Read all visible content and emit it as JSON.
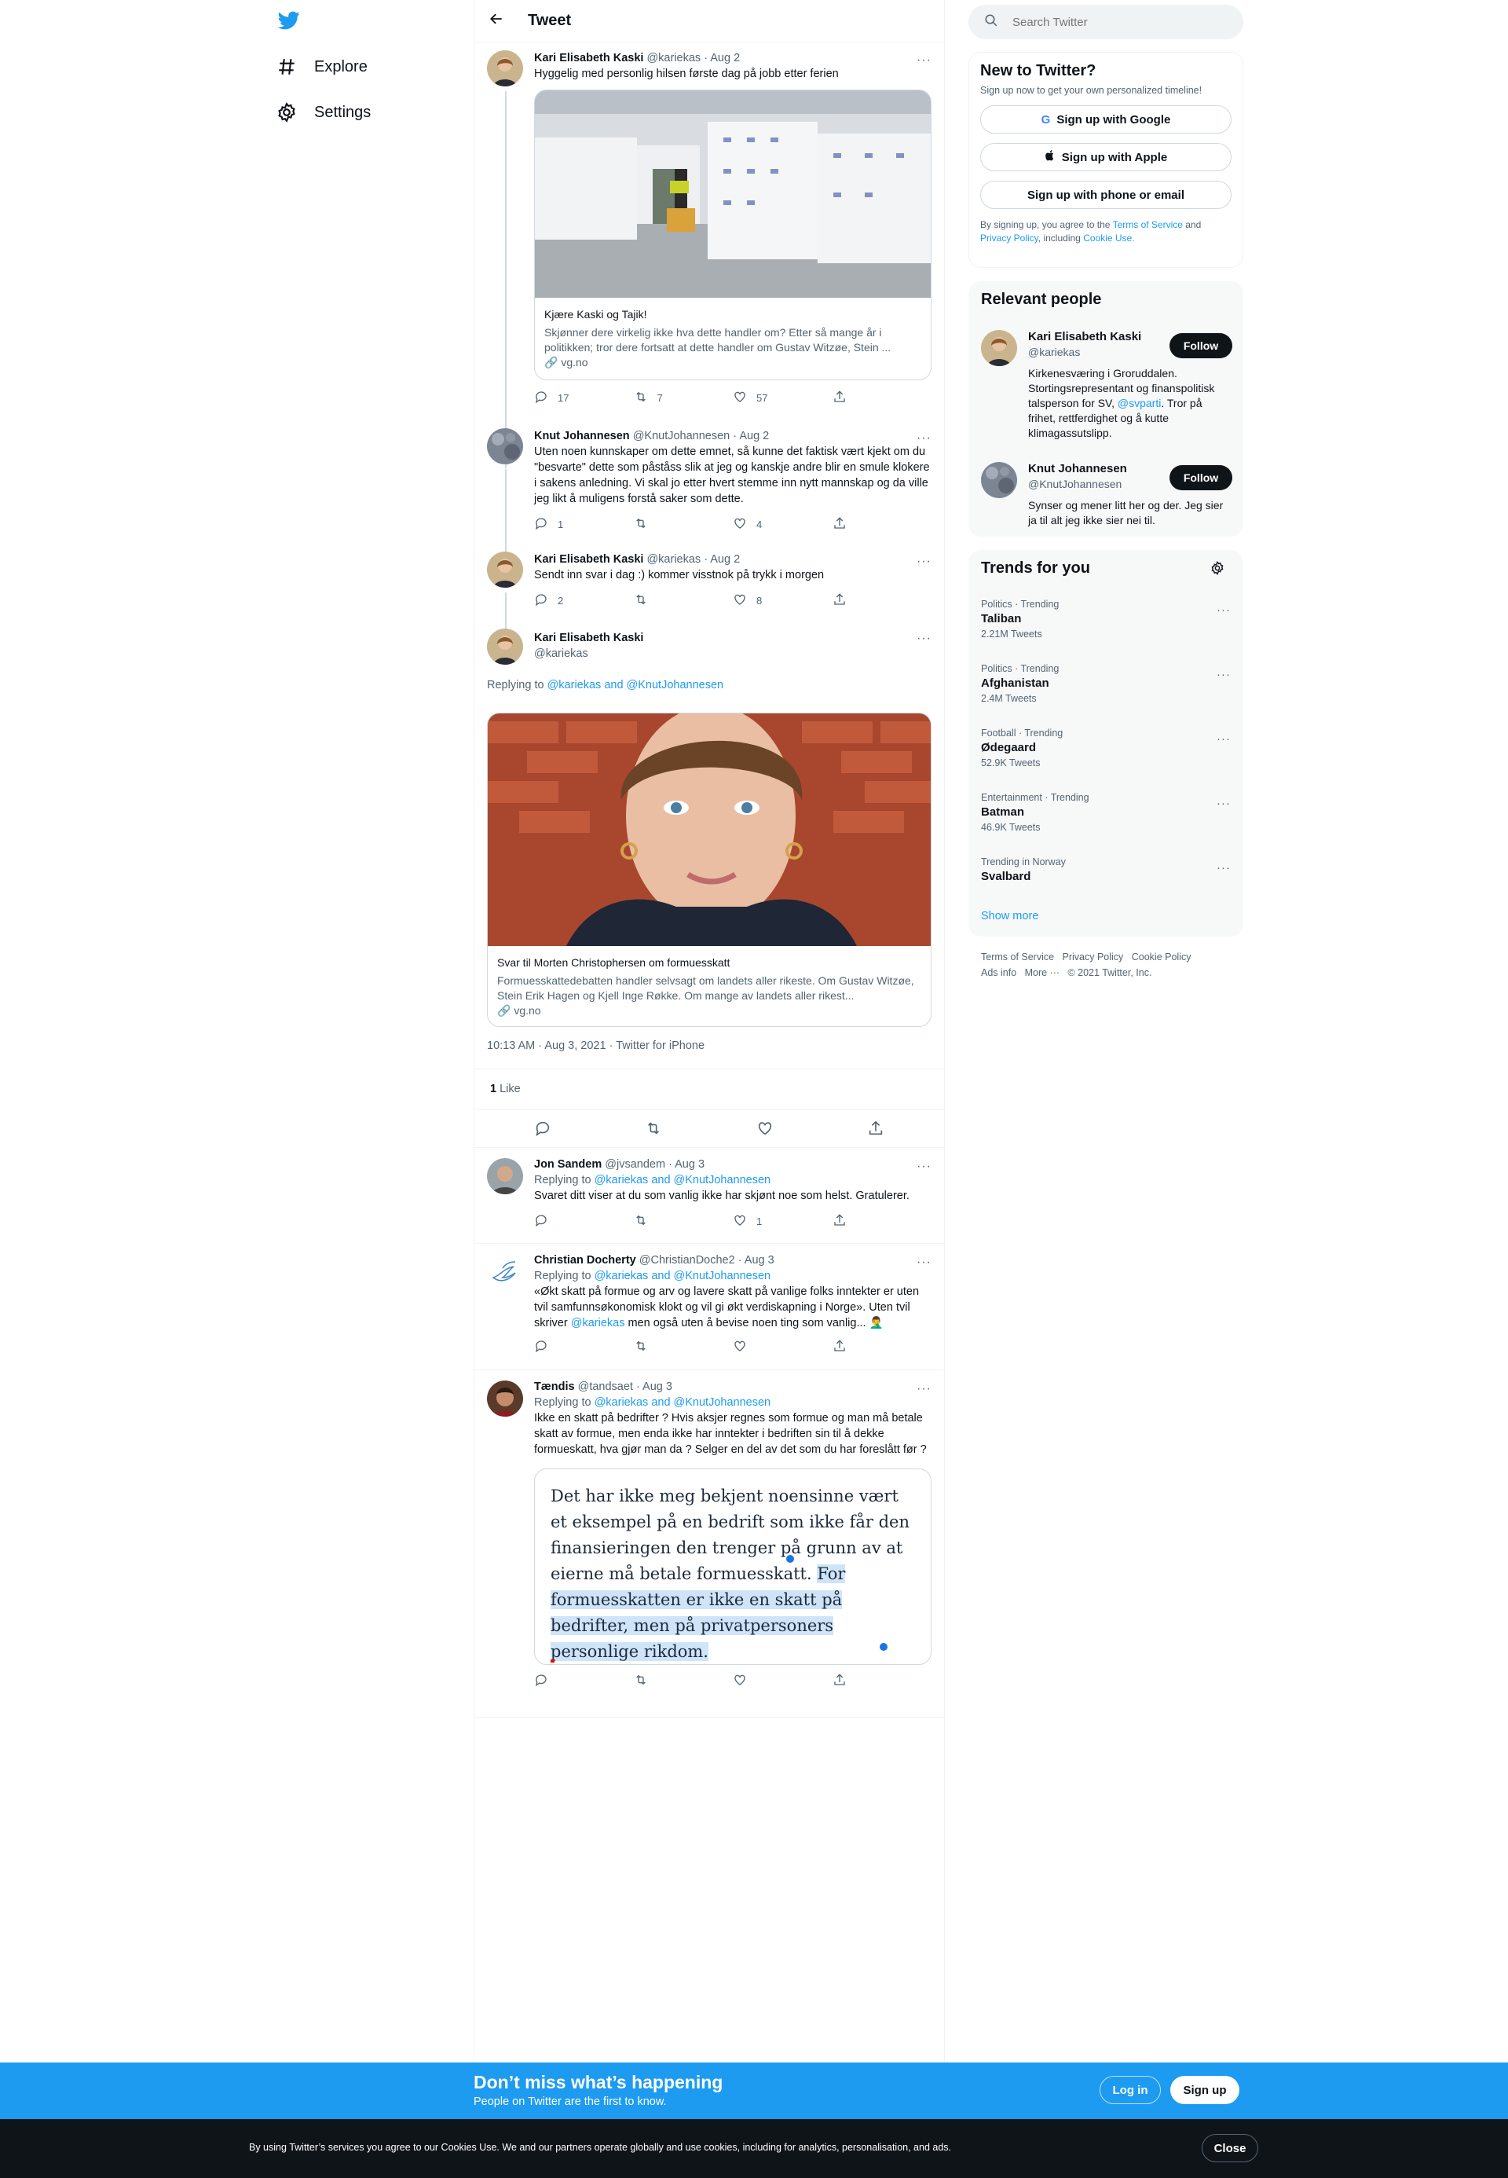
{
  "nav": {
    "explore": "Explore",
    "settings": "Settings"
  },
  "header": {
    "title": "Tweet"
  },
  "search": {
    "placeholder": "Search Twitter"
  },
  "signup": {
    "title": "New to Twitter?",
    "subtitle": "Sign up now to get your own personalized timeline!",
    "google": "Sign up with Google",
    "apple": "Sign up with Apple",
    "phone": "Sign up with phone or email",
    "legal_pre": "By signing up, you agree to the",
    "tos": "Terms of Service",
    "and": "and",
    "privacy": "Privacy Policy",
    "including": ", including",
    "cookie": "Cookie Use."
  },
  "relevant": {
    "title": "Relevant people",
    "people": [
      {
        "name": "Kari Elisabeth Kaski",
        "handle": "@kariekas",
        "follow": "Follow",
        "bio1": "Kirkenesværing i Groruddalen. Stortingsrepresentant og finanspolitisk talsperson for SV, ",
        "bio_link": "@svparti",
        "bio2": ". Tror på frihet, rettferdighet og å kutte klimagassutslipp."
      },
      {
        "name": "Knut Johannesen",
        "handle": "@KnutJohannesen",
        "follow": "Follow",
        "bio": "Synser og mener litt her og der. Jeg sier ja til alt jeg ikke sier nei til."
      }
    ]
  },
  "trends": {
    "title": "Trends for you",
    "items": [
      {
        "cat": "Politics · Trending",
        "name": "Taliban",
        "count": "2.21M Tweets"
      },
      {
        "cat": "Politics · Trending",
        "name": "Afghanistan",
        "count": "2.4M Tweets"
      },
      {
        "cat": "Football · Trending",
        "name": "Ødegaard",
        "count": "52.9K Tweets"
      },
      {
        "cat": "Entertainment · Trending",
        "name": "Batman",
        "count": "46.9K Tweets"
      },
      {
        "cat": "Trending in Norway",
        "name": "Svalbard",
        "count": ""
      }
    ],
    "show_more": "Show more"
  },
  "footer": {
    "tos": "Terms of Service",
    "privacy": "Privacy Policy",
    "cookie": "Cookie Policy",
    "ads": "Ads info",
    "more": "More ···",
    "copy": "© 2021 Twitter, Inc."
  },
  "thread": [
    {
      "name": "Kari Elisabeth Kaski",
      "handle": "@kariekas",
      "date": "· Aug 2",
      "text": "Hyggelig med personlig hilsen første dag på jobb etter ferien",
      "card_title": "Kjære Kaski og Tajik!",
      "card_desc": "Skjønner dere virkelig ikke hva dette handler om? Etter så mange år i politikken; tror dere fortsatt at dette handler om Gustav Witzøe, Stein ...",
      "card_domain": "vg.no",
      "replies": "17",
      "retweets": "7",
      "likes": "57"
    },
    {
      "name": "Knut Johannesen",
      "handle": "@KnutJohannesen",
      "date": "· Aug 2",
      "text": "Uten noen kunnskaper om dette emnet, så kunne det faktisk vært kjekt om du \"besvarte\" dette som påståss slik at jeg og kanskje andre blir en smule klokere i sakens anledning. Vi skal jo etter hvert stemme inn nytt mannskap og da ville jeg likt å muligens forstå saker som dette.",
      "replies": "1",
      "retweets": "",
      "likes": "4"
    },
    {
      "name": "Kari Elisabeth Kaski",
      "handle": "@kariekas",
      "date": "· Aug 2",
      "text": "Sendt inn svar i dag :) kommer visstnok på trykk i morgen",
      "replies": "2",
      "retweets": "",
      "likes": "8"
    }
  ],
  "main": {
    "name": "Kari Elisabeth Kaski",
    "handle": "@kariekas",
    "replying": "Replying to",
    "replying_to": "@kariekas and @KnutJohannesen",
    "card_title": "Svar til Morten Christophersen om formuesskatt",
    "card_desc": "Formuesskattedebatten handler selvsagt om landets aller rikeste. Om Gustav Witzøe, Stein Erik Hagen og Kjell Inge Røkke. Om mange av landets aller rikest...",
    "card_domain": "vg.no",
    "timestamp": "10:13 AM · Aug 3, 2021 · Twitter for iPhone",
    "likes_count": "1",
    "likes_label": "Like"
  },
  "replies": [
    {
      "name": "Jon Sandem",
      "handle": "@jvsandem",
      "date": "· Aug 3",
      "replying": "Replying to",
      "to": "@kariekas and @KnutJohannesen",
      "text": "Svaret ditt viser at du som vanlig ikke har skjønt noe som helst. Gratulerer.",
      "likes": "1"
    },
    {
      "name": "Christian Docherty",
      "handle": "@ChristianDoche2",
      "date": "· Aug 3",
      "replying": "Replying to",
      "to": "@kariekas and @KnutJohannesen",
      "text1": "«Økt skatt på formue og arv og lavere skatt på vanlige folks inntekter er uten tvil samfunnsøkonomisk klokt og vil gi økt verdiskapning i Norge». Uten tvil skriver ",
      "mention": "@kariekas",
      "text2": " men også uten å bevise noen ting som vanlig... 🤦‍♂️",
      "likes": ""
    },
    {
      "name": "Tændis",
      "handle": "@tandsaet",
      "date": "· Aug 3",
      "replying": "Replying to",
      "to": "@kariekas and @KnutJohannesen",
      "text": "Ikke en skatt på bedrifter ? Hvis aksjer regnes som formue og man må betale skatt av formue, men enda ikke har inntekter i bedriften sin til å dekke formueskatt, hva gjør man da ? Selger en del av det som du har foreslått før ?",
      "quote_plain": "Det har ikke meg bekjent noensinne vært et eksempel på en bedrift som ikke får den finansieringen den trenger på grunn av at eierne må betale formuesskatt. ",
      "quote_sel": "For formuesskatten er ikke en skatt på bedrifter, men på privatpersoners personlige rikdom.",
      "likes": ""
    }
  ],
  "banner": {
    "title": "Don’t miss what’s happening",
    "subtitle": "People on Twitter are the first to know.",
    "login": "Log in",
    "signup": "Sign up"
  },
  "cookie_bar": {
    "text": "By using Twitter’s services you agree to our Cookies Use. We and our partners operate globally and use cookies, including for analytics, personalisation, and ads.",
    "close": "Close"
  },
  "colors": {
    "accent": "#1d9bf0",
    "text": "#0f1419",
    "muted": "#536471",
    "border": "#eff3f4"
  }
}
